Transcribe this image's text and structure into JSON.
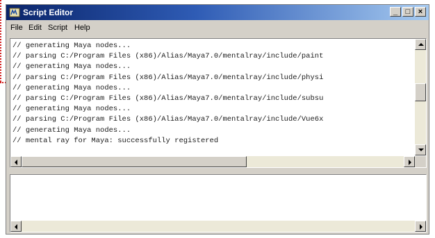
{
  "window": {
    "title": "Script Editor",
    "icon": "maya-script-icon",
    "controls": {
      "minimize": "_",
      "maximize": "□",
      "close": "×"
    }
  },
  "menubar": {
    "items": [
      {
        "label": "File"
      },
      {
        "label": "Edit"
      },
      {
        "label": "Script"
      },
      {
        "label": "Help"
      }
    ]
  },
  "output": {
    "lines": [
      "// generating Maya nodes...",
      "// parsing C:/Program Files (x86)/Alias/Maya7.0/mentalray/include/paint",
      "// generating Maya nodes...",
      "// parsing C:/Program Files (x86)/Alias/Maya7.0/mentalray/include/physi",
      "// generating Maya nodes...",
      "// parsing C:/Program Files (x86)/Alias/Maya7.0/mentalray/include/subsu",
      "// generating Maya nodes...",
      "// parsing C:/Program Files (x86)/Alias/Maya7.0/mentalray/include/Vue6x",
      "// generating Maya nodes...",
      "// mental ray for Maya: successfully registered"
    ]
  },
  "input": {
    "value": ""
  },
  "colors": {
    "callout": "#d32020",
    "titlebar_start": "#0a246a",
    "titlebar_end": "#a6caf0"
  }
}
